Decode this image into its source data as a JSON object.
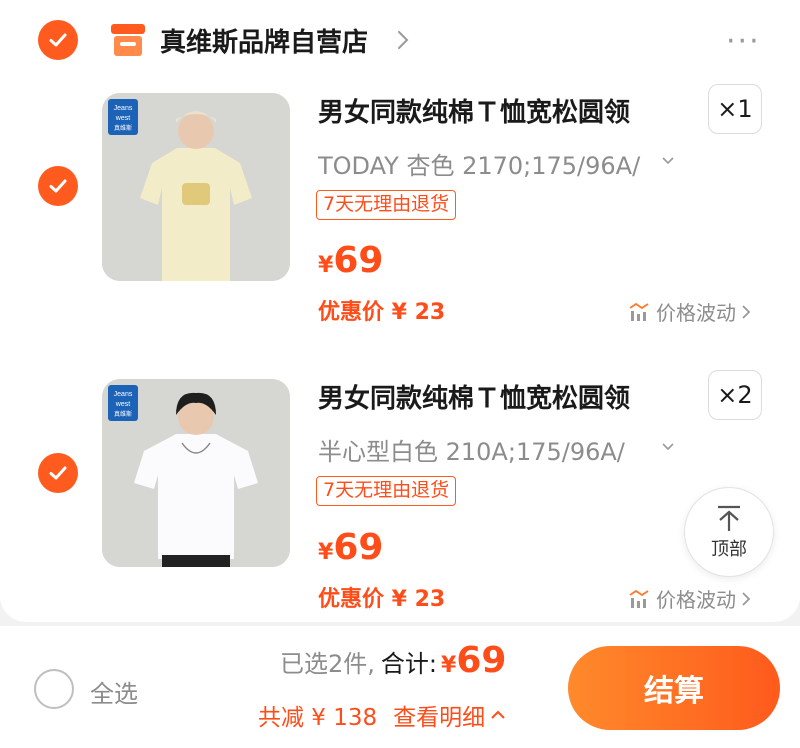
{
  "store": {
    "name": "真维斯品牌自营店",
    "more": "···"
  },
  "items": [
    {
      "title": "男女同款纯棉Ｔ恤宽松圆领",
      "sku": "TODAY 杏色 2170;175/96A/",
      "tag": "7天无理由退货",
      "qty": "×1",
      "currency": "¥",
      "price": "69",
      "promo_label": "优惠价 ¥ 23",
      "trend_label": "价格波动",
      "shirt_color": "#f2ecc9"
    },
    {
      "title": "男女同款纯棉Ｔ恤宽松圆领",
      "sku": "半心型白色 210A;175/96A/",
      "tag": "7天无理由退货",
      "qty": "×2",
      "currency": "¥",
      "price": "69",
      "promo_label": "优惠价 ¥ 23",
      "trend_label": "价格波动",
      "shirt_color": "#fbfbfd"
    }
  ],
  "thumb_brand": {
    "line1": "Jeans",
    "line2": "west",
    "line3": "真维斯"
  },
  "top_button": {
    "label": "顶部"
  },
  "bottom": {
    "select_all": "全选",
    "selected": "已选2件,",
    "total_label": "合计:",
    "currency": "¥",
    "total": "69",
    "saved": "共减 ¥ 138",
    "detail": "查看明细",
    "checkout": "结算"
  },
  "colors": {
    "accent": "#ff5b1f",
    "price": "#ff4d1a"
  }
}
